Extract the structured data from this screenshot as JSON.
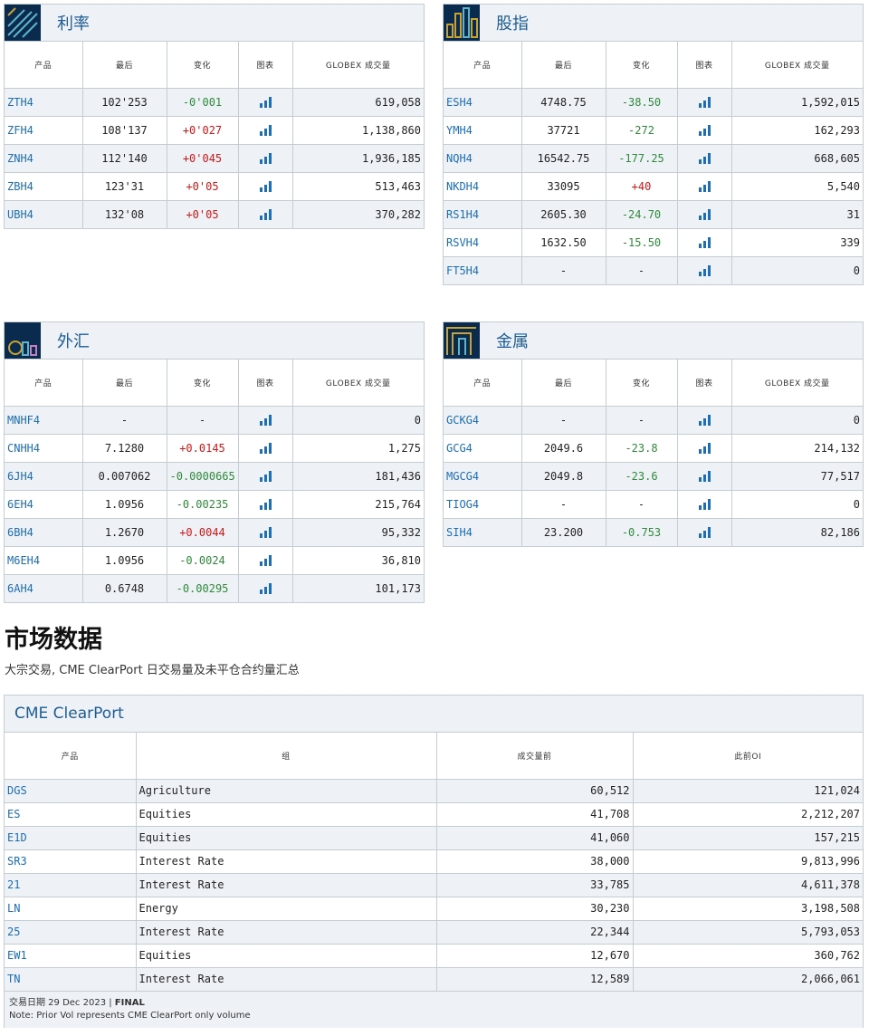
{
  "headers": [
    "产品",
    "最后",
    "变化",
    "图表",
    "GLOBEX 成交量"
  ],
  "rates": {
    "title": "利率",
    "rows": [
      {
        "sym": "ZTH4",
        "last": "102'253",
        "chg": "-0'001",
        "dir": "neg",
        "vol": "619,058"
      },
      {
        "sym": "ZFH4",
        "last": "108'137",
        "chg": "+0'027",
        "dir": "pos",
        "vol": "1,138,860"
      },
      {
        "sym": "ZNH4",
        "last": "112'140",
        "chg": "+0'045",
        "dir": "pos",
        "vol": "1,936,185"
      },
      {
        "sym": "ZBH4",
        "last": "123'31",
        "chg": "+0'05",
        "dir": "pos",
        "vol": "513,463"
      },
      {
        "sym": "UBH4",
        "last": "132'08",
        "chg": "+0'05",
        "dir": "pos",
        "vol": "370,282"
      }
    ]
  },
  "indices": {
    "title": "股指",
    "rows": [
      {
        "sym": "ESH4",
        "last": "4748.75",
        "chg": "-38.50",
        "dir": "neg",
        "vol": "1,592,015"
      },
      {
        "sym": "YMH4",
        "last": "37721",
        "chg": "-272",
        "dir": "neg",
        "vol": "162,293"
      },
      {
        "sym": "NQH4",
        "last": "16542.75",
        "chg": "-177.25",
        "dir": "neg",
        "vol": "668,605"
      },
      {
        "sym": "NKDH4",
        "last": "33095",
        "chg": "+40",
        "dir": "pos",
        "vol": "5,540"
      },
      {
        "sym": "RS1H4",
        "last": "2605.30",
        "chg": "-24.70",
        "dir": "neg",
        "vol": "31"
      },
      {
        "sym": "RSVH4",
        "last": "1632.50",
        "chg": "-15.50",
        "dir": "neg",
        "vol": "339"
      },
      {
        "sym": "FT5H4",
        "last": "-",
        "chg": "-",
        "dir": "neu",
        "vol": "0"
      }
    ]
  },
  "fx": {
    "title": "外汇",
    "rows": [
      {
        "sym": "MNHF4",
        "last": "-",
        "chg": "-",
        "dir": "neu",
        "vol": "0"
      },
      {
        "sym": "CNHH4",
        "last": "7.1280",
        "chg": "+0.0145",
        "dir": "pos",
        "vol": "1,275"
      },
      {
        "sym": "6JH4",
        "last": "0.007062",
        "chg": "-0.0000665",
        "dir": "neg",
        "vol": "181,436"
      },
      {
        "sym": "6EH4",
        "last": "1.0956",
        "chg": "-0.00235",
        "dir": "neg",
        "vol": "215,764"
      },
      {
        "sym": "6BH4",
        "last": "1.2670",
        "chg": "+0.0044",
        "dir": "pos",
        "vol": "95,332"
      },
      {
        "sym": "M6EH4",
        "last": "1.0956",
        "chg": "-0.0024",
        "dir": "neg",
        "vol": "36,810"
      },
      {
        "sym": "6AH4",
        "last": "0.6748",
        "chg": "-0.00295",
        "dir": "neg",
        "vol": "101,173"
      }
    ]
  },
  "metals": {
    "title": "金属",
    "rows": [
      {
        "sym": "GCKG4",
        "last": "-",
        "chg": "-",
        "dir": "neu",
        "vol": "0"
      },
      {
        "sym": "GCG4",
        "last": "2049.6",
        "chg": "-23.8",
        "dir": "neg",
        "vol": "214,132"
      },
      {
        "sym": "MGCG4",
        "last": "2049.8",
        "chg": "-23.6",
        "dir": "neg",
        "vol": "77,517"
      },
      {
        "sym": "TIOG4",
        "last": "-",
        "chg": "-",
        "dir": "neu",
        "vol": "0"
      },
      {
        "sym": "SIH4",
        "last": "23.200",
        "chg": "-0.753",
        "dir": "neg",
        "vol": "82,186"
      }
    ]
  },
  "market_data": {
    "title": "市场数据",
    "subtitle": "大宗交易, CME ClearPort 日交易量及未平仓合约量汇总"
  },
  "clearport": {
    "title": "CME ClearPort",
    "headers": [
      "产品",
      "组",
      "成交量前",
      "此前OI"
    ],
    "rows": [
      {
        "sym": "DGS",
        "group": "Agriculture",
        "vol": "60,512",
        "oi": "121,024"
      },
      {
        "sym": "ES",
        "group": "Equities",
        "vol": "41,708",
        "oi": "2,212,207"
      },
      {
        "sym": "E1D",
        "group": "Equities",
        "vol": "41,060",
        "oi": "157,215"
      },
      {
        "sym": "SR3",
        "group": "Interest Rate",
        "vol": "38,000",
        "oi": "9,813,996"
      },
      {
        "sym": "21",
        "group": "Interest Rate",
        "vol": "33,785",
        "oi": "4,611,378"
      },
      {
        "sym": "LN",
        "group": "Energy",
        "vol": "30,230",
        "oi": "3,198,508"
      },
      {
        "sym": "25",
        "group": "Interest Rate",
        "vol": "22,344",
        "oi": "5,793,053"
      },
      {
        "sym": "EW1",
        "group": "Equities",
        "vol": "12,670",
        "oi": "360,762"
      },
      {
        "sym": "TN",
        "group": "Interest Rate",
        "vol": "12,589",
        "oi": "2,066,061"
      }
    ],
    "footer_date_label": "交易日期 29 Dec 2023 |",
    "footer_status": "FINAL",
    "footer_note": "Note: Prior Vol represents CME ClearPort only volume"
  },
  "icons": {
    "chart": "bar-chart-icon"
  },
  "colors": {
    "link": "#1d6eb5",
    "negative": "#2e8b3a",
    "positive": "#d01818",
    "header_bg": "#eef2f6",
    "logo_bg": "#0a2b4e"
  }
}
